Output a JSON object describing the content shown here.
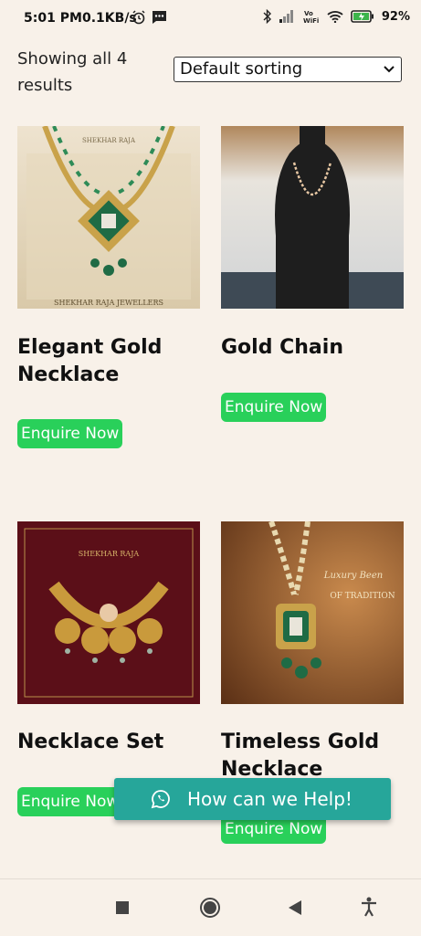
{
  "status_bar": {
    "time": "5:01 PM",
    "speed": "0.1KB/s",
    "battery": "92",
    "icons": [
      "alarm-icon",
      "message-icon",
      "bluetooth-icon",
      "signal-icon",
      "vowifi-icon",
      "wifi-icon",
      "battery-icon"
    ]
  },
  "shop": {
    "results_text": "Showing all 4 results",
    "sort_selected": "Default sorting"
  },
  "products": [
    {
      "title": "Elegant Gold Necklace",
      "button": "Enquire Now",
      "image_caption": "SHEKHAR RAJA JEWELLERS",
      "image_brand": "SHEKHAR RAJA"
    },
    {
      "title": "Gold Chain",
      "button": "Enquire Now"
    },
    {
      "title": "Necklace Set",
      "button": "Enquire Now",
      "image_brand": "SHEKHAR RAJA"
    },
    {
      "title": "Timeless Gold Necklace",
      "button": "Enquire Now",
      "image_caption": "OF TRADITION",
      "image_script": "Luxury Been"
    }
  ],
  "whatsapp": {
    "label": "How can we Help!"
  },
  "nav": {
    "icons": [
      "recents-square-icon",
      "home-circle-icon",
      "back-triangle-icon",
      "accessibility-icon"
    ]
  },
  "colors": {
    "background": "#f8f1e9",
    "button": "#29d05a",
    "whatsapp": "#26a69a"
  }
}
